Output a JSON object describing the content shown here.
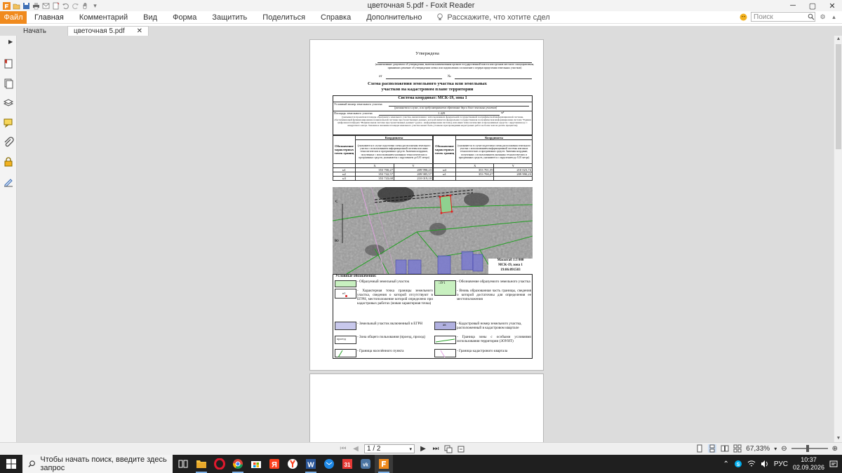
{
  "window": {
    "title": "цветочная 5.pdf - Foxit Reader"
  },
  "ribbon": {
    "file_label": "Файл",
    "tabs": [
      "Главная",
      "Комментарий",
      "Вид",
      "Форма",
      "Защитить",
      "Поделиться",
      "Справка",
      "Дополнительно"
    ],
    "tell_me": "Расскажите, что хотите сдел",
    "search_placeholder": "Поиск"
  },
  "doc_tabs": {
    "home": "Начать",
    "doc": "цветочная 5.pdf"
  },
  "pdf": {
    "approved": "Утверждена",
    "approved_note": "(наименование документа об утверждении, включая наименования органов государственной власти или органов местного самоуправления, принявших решение об утверждении схемы или подписавших соглашение о перераспределении земельных участков)",
    "from_label": "от",
    "no_label": "№",
    "main_title_1": "Схема расположения земельного участка или земельных",
    "main_title_2": "участков на кадастровом плане территории",
    "coord_system": "Система координат: МСК-19, зона 1",
    "conditional_number_label": "Условный номер земельного участка",
    "conditional_number_note": "(указывается в случае, если предусматривается образование двух и более земельных участков)",
    "area_label": "Площадь земельного участка",
    "area_value": "1 429",
    "area_unit": "м²",
    "area_note": "(указывается проектная площадь образуемого земельного участка, вычисленная с использованием федеральной государственной географической информационной системы, обеспечивающей функционирование национальной системы пространственных данных, которой является федеральная государственная географическая информационная система \"Единая цифровая платформа \"Национальная система пространственных данных\" (далее - информационная система), или иных технологических и программных средств с округлением до 1 квадратного метра. Указанное значение площади земельного участка может быть уточнено при проведении кадастровых работ не более чем на десять процентов)",
    "table": {
      "coords_header": "Координаты",
      "point_header": "Обозначение характерных точек границ",
      "coords_note": "(указываются в случае подготовки схемы расположения земельного участка с использованием информационной системы или иных технологических и программных средств. Значения координат, полученных с использованием указанных технологических и программных средств, указываются с округлением до 0,01 метра)",
      "col_x": "X",
      "col_y": "Y",
      "left_rows": [
        {
          "pt": "н1",
          "x": "353 700,27",
          "y": "209 990,23"
        },
        {
          "pt": "н2",
          "x": "353 742,57",
          "y": "209 985,57"
        },
        {
          "pt": "н3",
          "x": "353 743,68",
          "y": "210 019,10"
        }
      ],
      "right_rows": [
        {
          "pt": "н4",
          "x": "353 701,59",
          "y": "210 023,74"
        },
        {
          "pt": "н1",
          "x": "353 700,27",
          "y": "209 990,23"
        }
      ]
    },
    "map": {
      "north_letter": "С",
      "south_letter": "Ю",
      "scale": "Масштаб 1:3 000",
      "msk": "МСК-19, зона 1",
      "cadastral": "19:06:091503"
    },
    "legend": {
      "title": "Условные обозначения:",
      "items": [
        {
          "text": "- Образуемый земельный участок",
          "color": "#c8f0c0"
        },
        {
          "text": "- Обозначение образуемого земельного участка",
          "swatch_text": ":ЗУ1"
        },
        {
          "text": "- Характерная точка границы земельного участка, сведения о которой отсутствуют в ЕГРН, местоположение которой определено при кадастровых работах (новая характерная точка)",
          "swatch_text": "н1"
        },
        {
          "text": "- Вновь образованная часть границы, сведения о которой достаточны для определения ее местоположения"
        },
        {
          "text": "- Земельный участок включенный в ЕГРН",
          "color": "#c8c8ec"
        },
        {
          "text": "- Кадастровый номер земельного участка, расположенный в кадастровом квартале",
          "swatch_text": "ав"
        },
        {
          "text": "- Зона общего пользования (проезд, проход)",
          "swatch_text": "проезд"
        },
        {
          "text": "- Граница зоны с особыми условиями использования территории (ЗОУИТ)"
        },
        {
          "text": "- Граница населённого пункта"
        },
        {
          "text": "- Граница кадастрового квартала"
        }
      ]
    }
  },
  "statusbar": {
    "page_indicator": "1 / 2",
    "zoom": "67,33%",
    "zoom_fraction": 0.45
  },
  "taskbar": {
    "search_placeholder": "Чтобы начать поиск, введите здесь запрос",
    "lang": "РУС",
    "time": "10:37",
    "date": "02.09.2026",
    "calendar_badge": "31",
    "apps": [
      "task-view",
      "file-explorer",
      "opera",
      "chrome",
      "store",
      "yandex",
      "yandex-browser",
      "word",
      "mail",
      "calendar",
      "vk",
      "foxit-reader"
    ]
  },
  "colors": {
    "accent": "#f08a1d",
    "workspace": "#dcdcdc",
    "taskbar": "#1f1f1f"
  }
}
